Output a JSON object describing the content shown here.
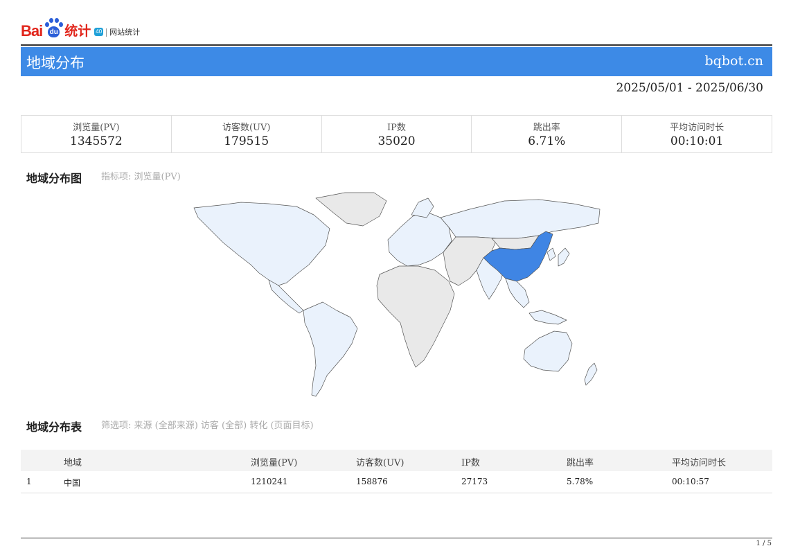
{
  "header": {
    "logo_text": "Bai",
    "logo_paw_text": "du",
    "logo_product": "统计",
    "logo_badge": "40",
    "logo_subtitle": "网站统计",
    "title": "地域分布",
    "site": "bqbot.cn",
    "date_range": "2025/05/01 - 2025/06/30"
  },
  "summary": [
    {
      "label": "浏览量(PV)",
      "value": "1345572"
    },
    {
      "label": "访客数(UV)",
      "value": "179515"
    },
    {
      "label": "IP数",
      "value": "35020"
    },
    {
      "label": "跳出率",
      "value": "6.71%"
    },
    {
      "label": "平均访问时长",
      "value": "00:10:01"
    }
  ],
  "map_section": {
    "title": "地域分布图",
    "note": "指标项: 浏览量(PV)",
    "colors": {
      "highlight": "#3f85e4",
      "light": "#eaf2fc",
      "none": "#e9e9e9",
      "border": "#555555"
    }
  },
  "table_section": {
    "title": "地域分布表",
    "note": "筛选项: 来源 (全部来源) 访客 (全部) 转化 (页面目标)",
    "columns": [
      "地域",
      "浏览量(PV)",
      "访客数(UV)",
      "IP数",
      "跳出率",
      "平均访问时长"
    ],
    "rows": [
      {
        "index": "1",
        "region": "中国",
        "pv": "1210241",
        "uv": "158876",
        "ip": "27173",
        "bounce": "5.78%",
        "duration": "00:10:57"
      }
    ]
  },
  "footer": {
    "page": "1 / 5"
  }
}
